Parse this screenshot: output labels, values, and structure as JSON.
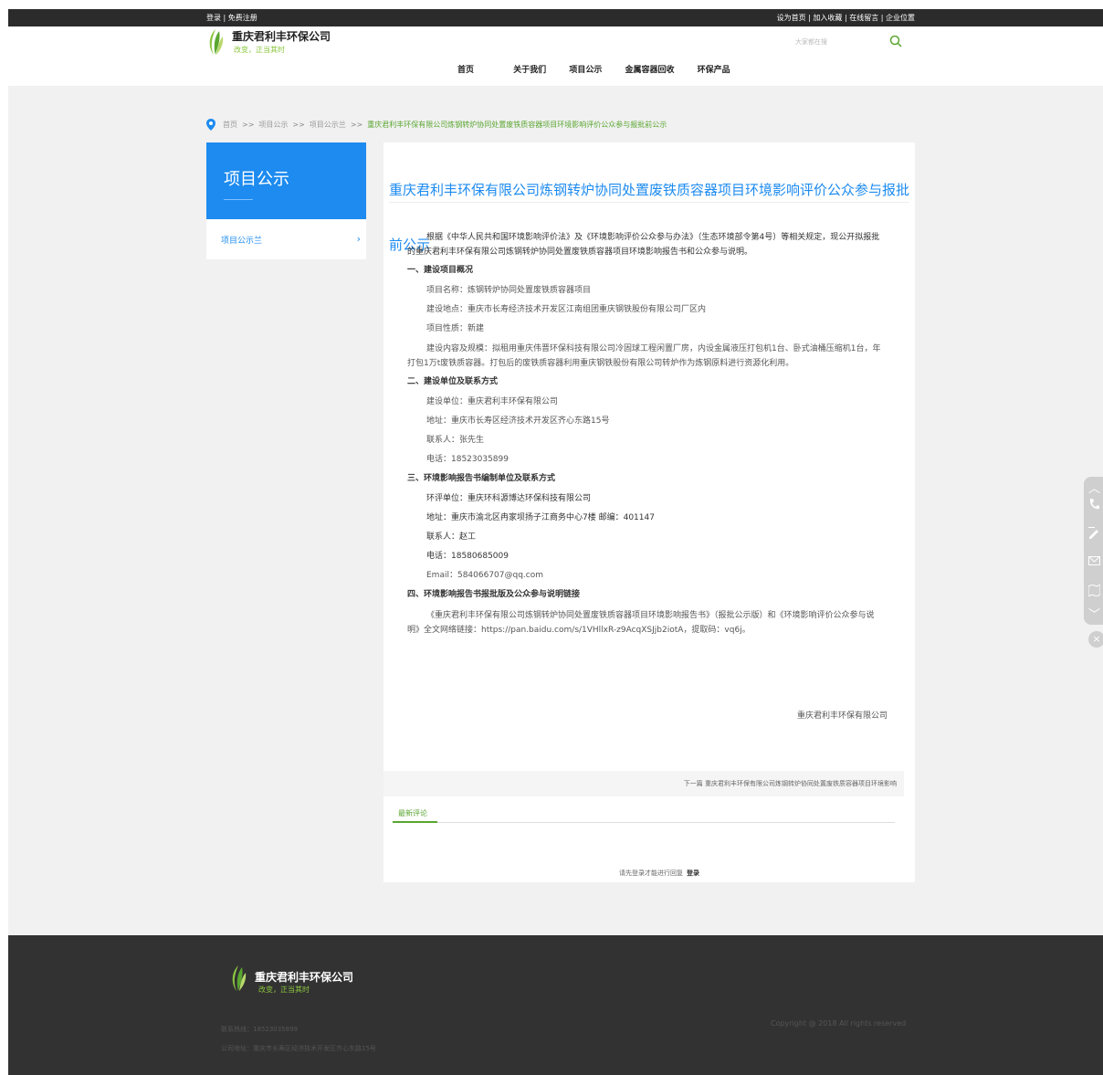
{
  "topbar": {
    "left": "登录 | 免费注册",
    "right": "设为首页 | 加入收藏 | 在线留言 | 企业位置"
  },
  "header": {
    "company": "重庆君利丰环保公司",
    "slogan": "改变，正当其时",
    "nav": [
      "首页",
      "关于我们",
      "项目公示",
      "金属容器回收",
      "环保产品"
    ],
    "search_placeholder": "大家都在搜",
    "search_icon": "search-icon"
  },
  "breadcrumb": {
    "items": [
      "首页",
      "项目公示",
      "项目公示兰"
    ],
    "separator": ">>",
    "current": "重庆君利丰环保有限公司炼钢转炉协同处置废铁质容器项目环境影响评价公众参与报批前公示"
  },
  "sidebar": {
    "title": "项目公示",
    "item": "项目公示兰",
    "chevron": "›"
  },
  "article": {
    "title": "重庆君利丰环保有限公司炼钢转炉协同处置废铁质容器项目环境影响评价公众参与报批前公示",
    "intro": "根据《中华人民共和国环境影响评价法》及《环境影响评价公众参与办法》（生态环境部令第4号）等相关规定，现公开拟报批的重庆君利丰环保有限公司炼钢转炉协同处置废铁质容器项目环境影响报告书和公众参与说明。",
    "sec1": "一、建设项目概况",
    "s1_name": "项目名称：炼钢转炉协同处置废铁质容器项目",
    "s1_place": "建设地点：重庆市长寿经济技术开发区江南组团重庆钢铁股份有限公司厂区内",
    "s1_nature": "项目性质：新建",
    "s1_scale": "建设内容及规模：拟租用重庆伟晋环保科技有限公司冷固球工程闲置厂房，内设金属液压打包机1台、卧式油桶压缩机1台，年打包1万t废铁质容器。打包后的废铁质容器利用重庆钢铁股份有限公司转炉作为炼钢原料进行资源化利用。",
    "sec2": "二、建设单位及联系方式",
    "s2_unit": "建设单位：重庆君利丰环保有限公司",
    "s2_addr": "地址：重庆市长寿区经济技术开发区齐心东路15号",
    "s2_contact": "联系人：张先生",
    "s2_tel": "电话：18523035899",
    "sec3": "三、环境影响报告书编制单位及联系方式",
    "s3_unit": "环评单位：重庆环科源博达环保科技有限公司",
    "s3_addr": "地址：重庆市渝北区冉家坝扬子江商务中心7楼    邮编：401147",
    "s3_contact": "联系人：赵工",
    "s3_tel": "电话：18580685009",
    "s3_email": "Email：584066707@qq.com",
    "sec4": "四、环境影响报告书报批版及公众参与说明链接",
    "s4_text": "《重庆君利丰环保有限公司炼钢转炉协同处置废铁质容器项目环境影响报告书》（报批公示版）和《环境影响评价公众参与说明》全文网络链接：https://pan.baidu.com/s/1VHllxR-z9AcqXSJjb2iotA，提取码：vq6j。",
    "signature": "重庆君利丰环保有限公司"
  },
  "next": "下一篇  重庆君利丰环保有限公司炼钢转炉协同处置废铁质容器项目环境影响",
  "comments": {
    "tab": "最新评论",
    "tip": "请先登录才能进行回复",
    "login": "登录"
  },
  "float_icons": [
    "up-icon",
    "phone-icon",
    "edit-icon",
    "mail-icon",
    "map-icon",
    "down-icon",
    "close-icon"
  ],
  "footer": {
    "company": "重庆君利丰环保公司",
    "slogan": "改变，正当其时",
    "hotline": "联系热线：18523035899",
    "address": "公司地址：重庆市长寿区经济技术开发区齐心东路15号",
    "copyright": "Copyright @ 2018   All rights reserved"
  },
  "colors": {
    "accent_blue": "#1d8bf0",
    "accent_green": "#5aa631",
    "dark_bar": "#2b2b2b",
    "footer_bg": "#323232"
  }
}
